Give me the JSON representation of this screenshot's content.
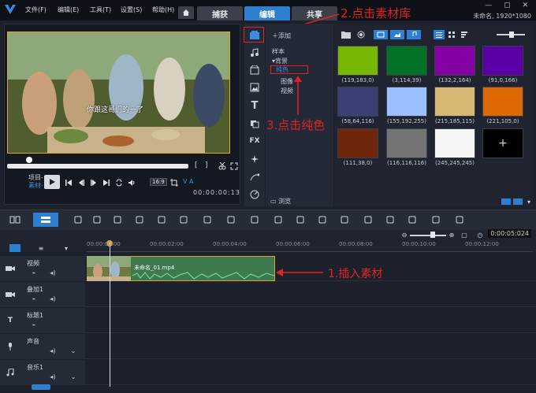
{
  "menu": {
    "file": "文件(F)",
    "edit": "编辑(E)",
    "tools": "工具(T)",
    "settings": "设置(S)",
    "help": "帮助(H)"
  },
  "tabs": {
    "capture": "捕获",
    "edit": "编辑",
    "share": "共享"
  },
  "status": "未命名, 1920*1080",
  "preview": {
    "subtitle": "你跟这哥们的一了",
    "project_label": "项目-",
    "clip_label": "素材-",
    "ratio": "16:9",
    "timecode": "00:00:00:13",
    "va": "V A"
  },
  "library": {
    "add": "添加",
    "samples": "样本",
    "background": "背景",
    "plain_color": "纯色",
    "image": "图像",
    "video": "视频",
    "browse": "浏览"
  },
  "colors": [
    {
      "hex": "#77b703",
      "label": "(119,183,0)"
    },
    {
      "hex": "#037227",
      "label": "(3,114,39)"
    },
    {
      "hex": "#8402a4",
      "label": "(132,2,164)"
    },
    {
      "hex": "#5b00a6",
      "label": "(91,0,166)"
    },
    {
      "hex": "#3a4074",
      "label": "(58,64,116)"
    },
    {
      "hex": "#9bc0ff",
      "label": "(155,192,255)"
    },
    {
      "hex": "#d7b973",
      "label": "(215,185,115)"
    },
    {
      "hex": "#dd6900",
      "label": "(221,105,0)"
    },
    {
      "hex": "#6f260a",
      "label": "(111,38,0)"
    },
    {
      "hex": "#747474",
      "label": "(116,116,116)"
    },
    {
      "hex": "#f5f5f5",
      "label": "(245,245,245)"
    }
  ],
  "add_color": "+",
  "timeline": {
    "timecode": "0:00:05:024",
    "ruler": [
      "00:00:00:00",
      "00:00:02:00",
      "00:00:04:00",
      "00:00:06:00",
      "00:00:08:00",
      "00:00:10:00",
      "00:00:12:00"
    ],
    "tracks": {
      "video": "视频",
      "overlay": "叠加1",
      "title": "标题1",
      "voice": "声音",
      "music": "音乐1"
    },
    "clip_name": "未命名_01.mp4"
  },
  "annotations": {
    "step1": "1.插入素材",
    "step2": "2.点击素材库",
    "step3": "3.点击纯色"
  }
}
